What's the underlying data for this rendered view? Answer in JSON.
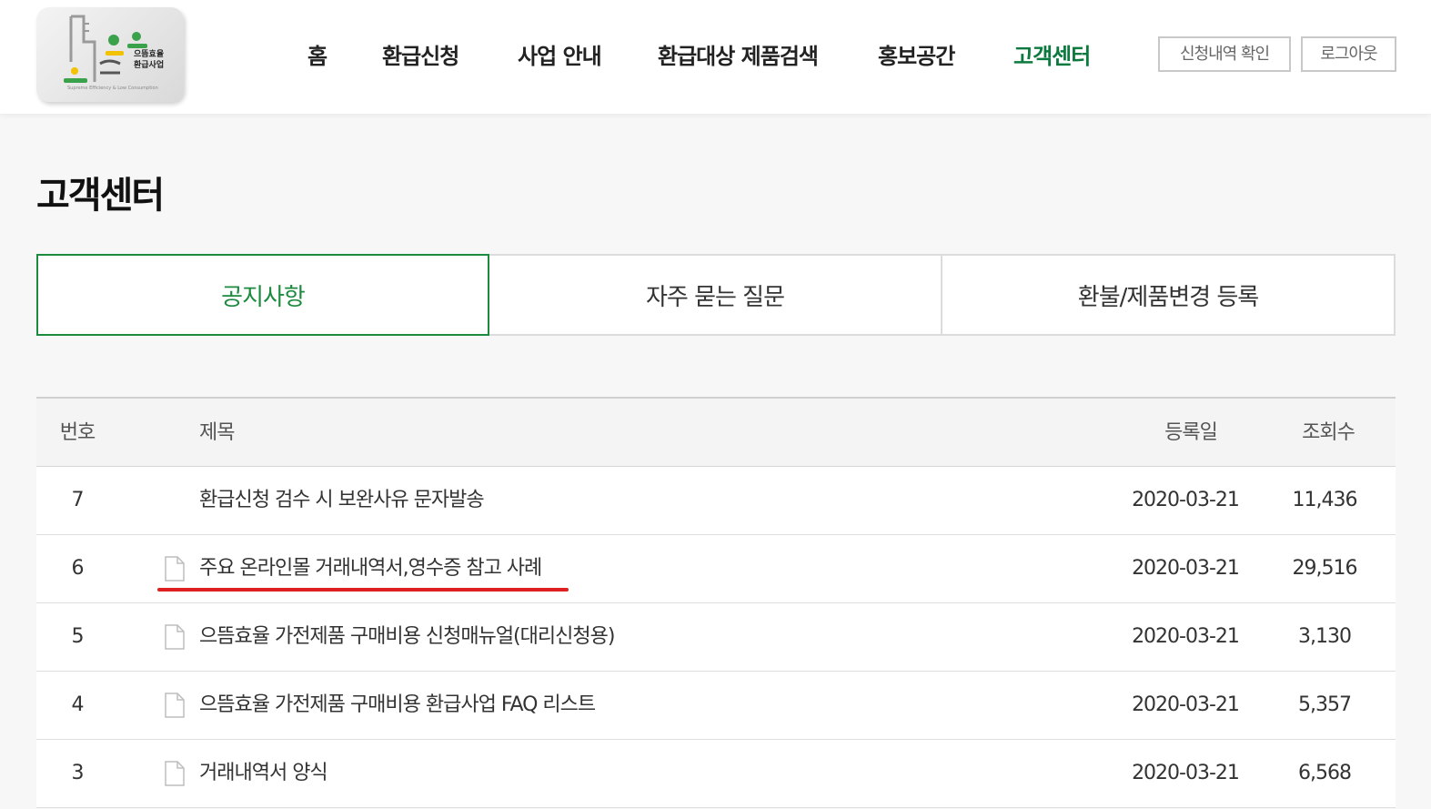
{
  "logo": {
    "text_line1": "으뜸효율",
    "text_line2": "환급사업",
    "subtitle": "Supreme Efficiency & Low Consumption"
  },
  "nav": {
    "items": [
      {
        "label": "홈",
        "active": false
      },
      {
        "label": "환급신청",
        "active": false
      },
      {
        "label": "사업 안내",
        "active": false
      },
      {
        "label": "환급대상 제품검색",
        "active": false
      },
      {
        "label": "홍보공간",
        "active": false
      },
      {
        "label": "고객센터",
        "active": true
      }
    ],
    "check_button": "신청내역 확인",
    "logout_button": "로그아웃"
  },
  "page": {
    "title": "고객센터"
  },
  "tabs": [
    {
      "label": "공지사항",
      "active": true
    },
    {
      "label": "자주 묻는 질문",
      "active": false
    },
    {
      "label": "환불/제품변경 등록",
      "active": false
    }
  ],
  "table": {
    "headers": {
      "num": "번호",
      "title": "제목",
      "date": "등록일",
      "views": "조회수"
    },
    "rows": [
      {
        "num": "7",
        "title": "환급신청 검수 시 보완사유 문자발송",
        "date": "2020-03-21",
        "views": "11,436",
        "has_file": false
      },
      {
        "num": "6",
        "title": "주요 온라인몰 거래내역서,영수증 참고 사례",
        "date": "2020-03-21",
        "views": "29,516",
        "has_file": true
      },
      {
        "num": "5",
        "title": "으뜸효율 가전제품 구매비용 신청매뉴얼(대리신청용)",
        "date": "2020-03-21",
        "views": "3,130",
        "has_file": true
      },
      {
        "num": "4",
        "title": "으뜸효율 가전제품 구매비용 환급사업 FAQ 리스트",
        "date": "2020-03-21",
        "views": "5,357",
        "has_file": true
      },
      {
        "num": "3",
        "title": "거래내역서 양식",
        "date": "2020-03-21",
        "views": "6,568",
        "has_file": true
      }
    ]
  },
  "colors": {
    "accent_green": "#1c8a3f",
    "nav_active": "#0c7a3e",
    "highlight_red": "#e02020"
  }
}
